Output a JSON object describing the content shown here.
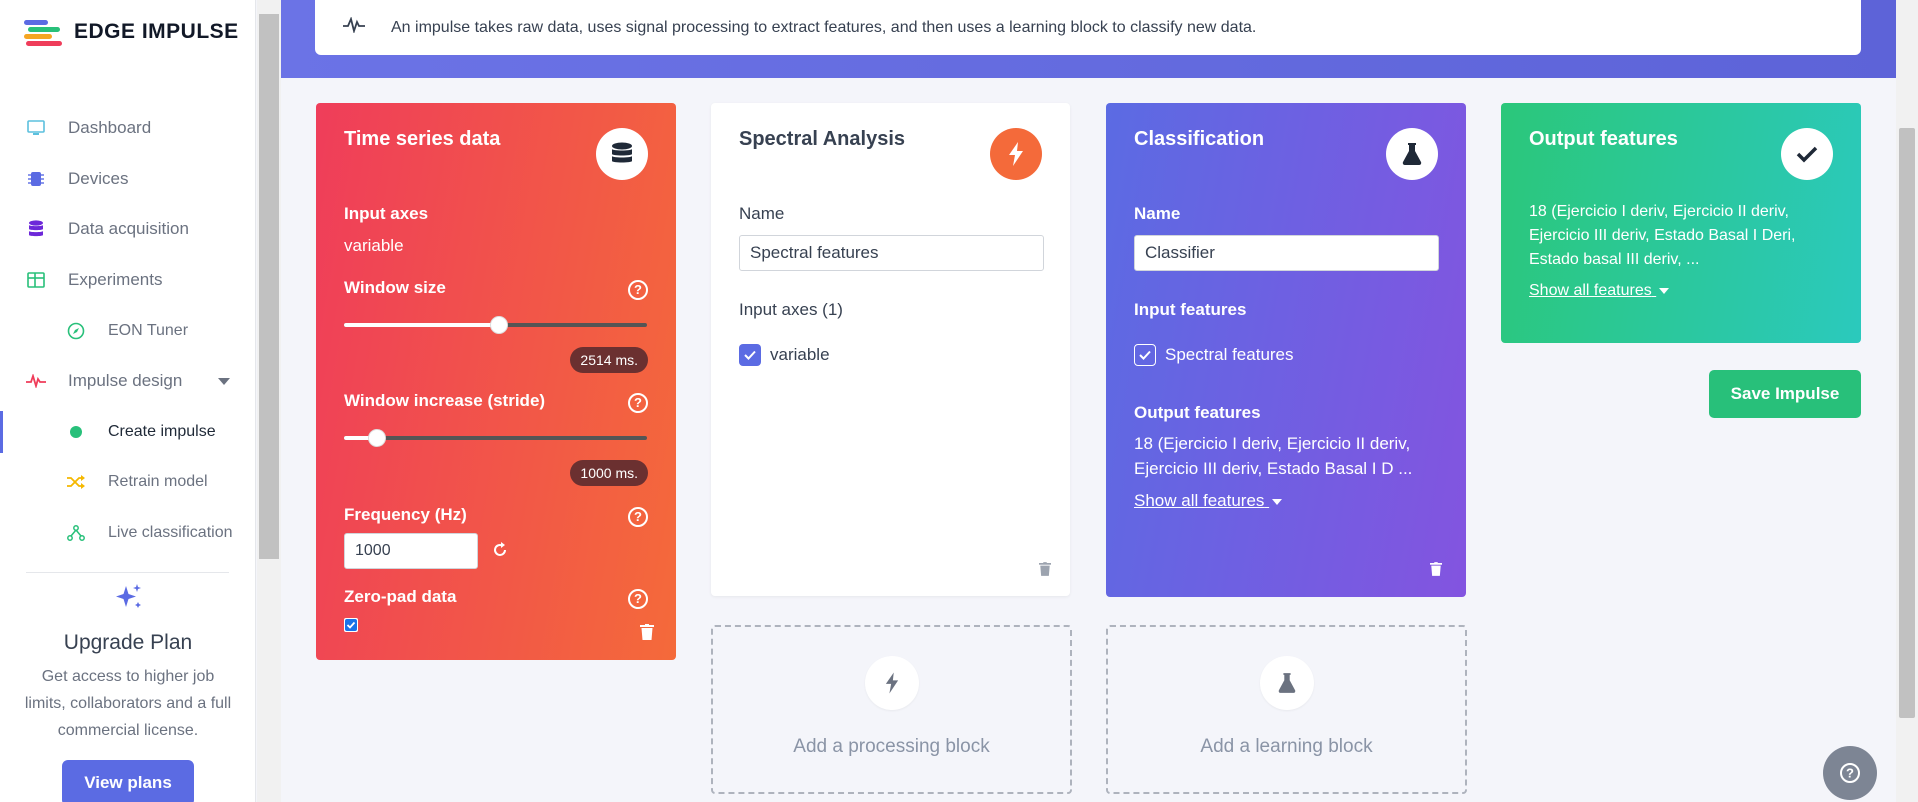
{
  "brand": {
    "name": "EDGE IMPULSE"
  },
  "sidebar": {
    "items": [
      {
        "label": "Dashboard",
        "icon": "monitor-icon"
      },
      {
        "label": "Devices",
        "icon": "chip-icon"
      },
      {
        "label": "Data acquisition",
        "icon": "database-icon"
      },
      {
        "label": "Experiments",
        "icon": "table-icon"
      },
      {
        "label": "EON Tuner",
        "icon": "compass-icon"
      },
      {
        "label": "Impulse design",
        "icon": "pulse-icon"
      },
      {
        "label": "Create impulse",
        "icon": "dot-icon"
      },
      {
        "label": "Retrain model",
        "icon": "shuffle-icon"
      },
      {
        "label": "Live classification",
        "icon": "branch-icon"
      }
    ],
    "upgrade": {
      "title": "Upgrade Plan",
      "text": "Get access to higher job limits, collaborators and a full commercial license.",
      "button": "View plans"
    }
  },
  "hero": {
    "text": "An impulse takes raw data, uses signal processing to extract features, and then uses a learning block to classify new data."
  },
  "time_series": {
    "title": "Time series data",
    "input_axes_label": "Input axes",
    "input_axes_value": "variable",
    "window_size_label": "Window size",
    "window_size_value": "2514 ms.",
    "window_size_fraction": 0.51,
    "window_increase_label": "Window increase (stride)",
    "window_increase_value": "1000 ms.",
    "window_increase_fraction": 0.11,
    "frequency_label": "Frequency (Hz)",
    "frequency_value": "1000",
    "zero_pad_label": "Zero-pad data",
    "zero_pad_checked": true
  },
  "spectral": {
    "title": "Spectral Analysis",
    "name_label": "Name",
    "name_value": "Spectral features",
    "input_axes_label": "Input axes (1)",
    "axis_item": "variable"
  },
  "classification": {
    "title": "Classification",
    "name_label": "Name",
    "name_value": "Classifier",
    "input_features_label": "Input features",
    "input_feature_item": "Spectral features",
    "output_features_label": "Output features",
    "output_line1": "18 (Ejercicio I deriv, Ejercicio II deriv,",
    "output_line2": "Ejercicio III deriv, Estado Basal I D ...",
    "show_all": "Show all features"
  },
  "output_features": {
    "title": "Output features",
    "line1": "18 (Ejercicio I deriv, Ejercicio II deriv,",
    "line2": "Ejercicio III deriv, Estado Basal I Deri,",
    "line3": "Estado basal III deriv, ...",
    "show_all": "Show all features"
  },
  "add_processing": {
    "label": "Add a processing block"
  },
  "add_learning": {
    "label": "Add a learning block"
  },
  "save_button": "Save Impulse",
  "colors": {
    "accent": "#5b6be3",
    "time_series_from": "#ef3d5a",
    "time_series_to": "#f46a3a",
    "classification_from": "#5b6be3",
    "classification_to": "#8354e0",
    "output_from": "#2bc77a",
    "output_to": "#2bc9bd",
    "save": "#28c07a"
  }
}
